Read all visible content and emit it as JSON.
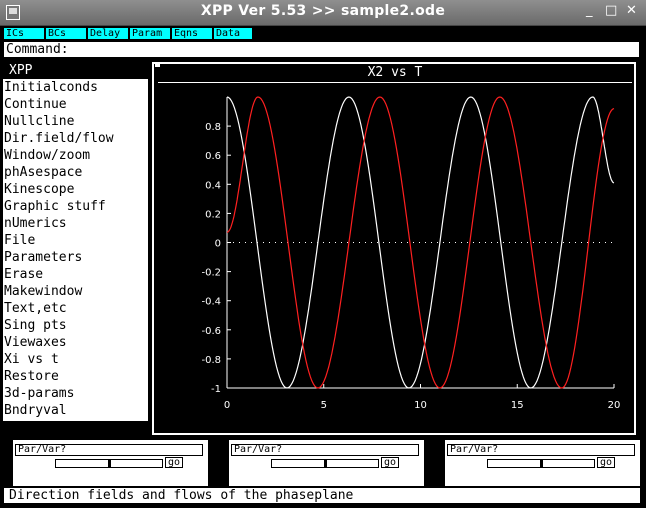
{
  "window": {
    "title": "XPP Ver 5.53 >> sample2.ode",
    "controls": {
      "minimize": "_",
      "maximize": "□",
      "close": "✕"
    }
  },
  "toolbar": {
    "buttons": [
      "ICs",
      "BCs",
      "Delay",
      "Param",
      "Eqns",
      "Data"
    ]
  },
  "command": {
    "label": "Command:"
  },
  "menu": {
    "title": "XPP",
    "items": [
      "Initialconds",
      "Continue",
      "Nullcline",
      "Dir.field/flow",
      "Window/zoom",
      "phAsespace",
      "Kinescope",
      "Graphic stuff",
      "nUmerics",
      "File",
      "Parameters",
      "Erase",
      "Makewindow",
      "Text,etc",
      "Sing pts",
      "Viewaxes",
      "Xi vs t",
      "Restore",
      "3d-params",
      "Bndryval"
    ]
  },
  "colors": {
    "background": "#000000",
    "toolbar_button": "#00ffff",
    "curve_1": "#ffffff",
    "curve_2": "#ff2020"
  },
  "chart_data": {
    "type": "line",
    "title": "X2 vs T",
    "xlabel": "",
    "ylabel": "",
    "xlim": [
      0,
      20
    ],
    "ylim": [
      -1,
      1
    ],
    "x_ticks": [
      "0",
      "5",
      "10",
      "15",
      "20"
    ],
    "y_ticks": [
      "0.8",
      "0.6",
      "0.4",
      "0.2",
      "0",
      "-0.2",
      "-0.4",
      "-0.6",
      "-0.8",
      "-1"
    ],
    "zero_line": "dotted",
    "series": [
      {
        "color": "#ffffff",
        "x": [
          0,
          3.1,
          6.3,
          9.4,
          12.6,
          15.7,
          18.9,
          20
        ],
        "y": [
          1,
          -1,
          1,
          -1,
          1,
          -1,
          1,
          0.41
        ]
      },
      {
        "color": "#ff2020",
        "x": [
          0,
          1.6,
          4.7,
          7.9,
          11.0,
          14.1,
          17.3,
          20
        ],
        "y": [
          0.07,
          1,
          -1,
          1,
          -1,
          1,
          -1,
          0.92
        ]
      }
    ]
  },
  "sliders": [
    {
      "label": "Par/Var?",
      "go": "go",
      "position": 0.5
    },
    {
      "label": "Par/Var?",
      "go": "go",
      "position": 0.5
    },
    {
      "label": "Par/Var?",
      "go": "go",
      "position": 0.5
    }
  ],
  "status": {
    "text": "Direction fields and flows of the phaseplane"
  }
}
